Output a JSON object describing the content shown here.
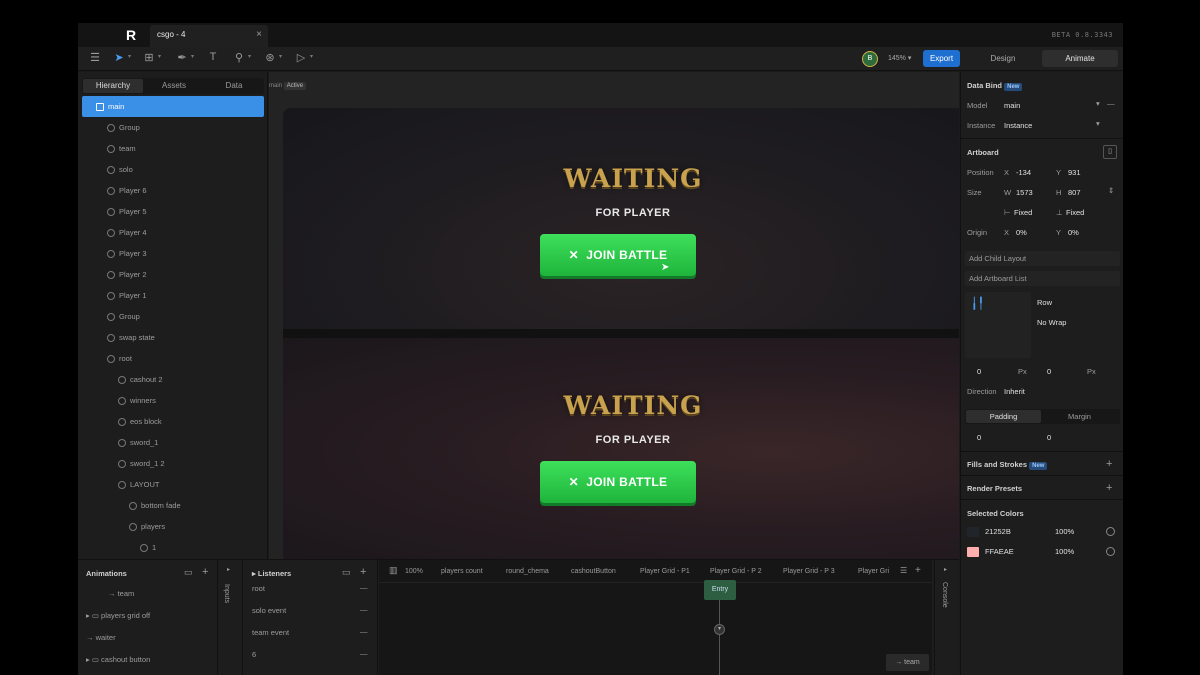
{
  "window": {
    "tab_title": "csgo - 4",
    "close_glyph": "×",
    "build": "BETA 0.8.3343"
  },
  "toolbar": {
    "avatar_initial": "B",
    "zoom": "145%",
    "export": "Export",
    "mode_design": "Design",
    "mode_animate": "Animate"
  },
  "left": {
    "tabs": [
      "Hierarchy",
      "Assets",
      "Data"
    ],
    "tree": [
      {
        "label": "main",
        "depth": 0,
        "selected": true
      },
      {
        "label": "Group",
        "depth": 1
      },
      {
        "label": "team",
        "depth": 1
      },
      {
        "label": "solo",
        "depth": 1
      },
      {
        "label": "Player 6",
        "depth": 1
      },
      {
        "label": "Player 5",
        "depth": 1
      },
      {
        "label": "Player 4",
        "depth": 1
      },
      {
        "label": "Player 3",
        "depth": 1
      },
      {
        "label": "Player 2",
        "depth": 1
      },
      {
        "label": "Player 1",
        "depth": 1
      },
      {
        "label": "Group",
        "depth": 1
      },
      {
        "label": "swap state",
        "depth": 1
      },
      {
        "label": "root",
        "depth": 1
      },
      {
        "label": "cashout 2",
        "depth": 2
      },
      {
        "label": "winners",
        "depth": 2
      },
      {
        "label": "eos block",
        "depth": 2
      },
      {
        "label": "sword_1",
        "depth": 2
      },
      {
        "label": "sword_1 2",
        "depth": 2
      },
      {
        "label": "LAYOUT",
        "depth": 2
      },
      {
        "label": "bottom fade",
        "depth": 3
      },
      {
        "label": "players",
        "depth": 3
      },
      {
        "label": "1",
        "depth": 4
      }
    ]
  },
  "canvas": {
    "breadcrumb": "main",
    "state_badge": "Active",
    "panels": [
      {
        "title": "WAITING",
        "subtitle": "FOR PLAYER",
        "button": "JOIN BATTLE"
      },
      {
        "title": "WAITING",
        "subtitle": "FOR PLAYER",
        "button": "JOIN BATTLE"
      }
    ]
  },
  "right": {
    "data_bind": "Data Bind",
    "new_badge": "New",
    "model_label": "Model",
    "model_value": "main",
    "instance_label": "Instance",
    "instance_value": "Instance",
    "artboard": "Artboard",
    "position_label": "Position",
    "x_label": "X",
    "x_value": "-134",
    "y_label": "Y",
    "y_value": "931",
    "size_label": "Size",
    "w_label": "W",
    "w_value": "1573",
    "h_label": "H",
    "h_value": "807",
    "fixed_w": "Fixed",
    "fixed_h": "Fixed",
    "origin_label": "Origin",
    "ox_value": "0%",
    "oy_value": "0%",
    "add_child_layout": "Add Child Layout",
    "add_artboard_list": "Add Artboard List",
    "row": "Row",
    "nowrap": "No Wrap",
    "gap_a": "0",
    "gap_b": "0",
    "px1": "Px",
    "px2": "Px",
    "direction_label": "Direction",
    "direction_value": "Inherit",
    "padding_tab": "Padding",
    "margin_tab": "Margin",
    "pad_a": "0",
    "pad_b": "0",
    "fills_strokes": "Fills and Strokes",
    "render_presets": "Render Presets",
    "selected_colors": "Selected Colors",
    "colors": [
      {
        "hex": "21252B",
        "opacity": "100%",
        "swatch": "#21252B"
      },
      {
        "hex": "FFAEAE",
        "opacity": "100%",
        "swatch": "#FFAEAE"
      }
    ]
  },
  "bottom": {
    "animations_title": "Animations",
    "animations": [
      "team",
      "players grid off",
      "waiter",
      "cashout button"
    ],
    "inputs_label": "Inputs",
    "listeners_title": "Listeners",
    "listeners": [
      "root",
      "solo event",
      "team event",
      "6"
    ],
    "timeline_zoom": "100%",
    "timeline_tabs": [
      "players count",
      "round_chema",
      "cashoutButton",
      "Player Grid - P1",
      "Player Grid - P 2",
      "Player Grid - P 3",
      "Player Gri"
    ],
    "entry": "Entry",
    "team_node": "→ team",
    "console_label": "Console"
  },
  "colors": {
    "accent": "#3a8fe6",
    "export": "#1e6fd0",
    "join_green": "#2ecc4f",
    "gold": "#c9a24d"
  }
}
